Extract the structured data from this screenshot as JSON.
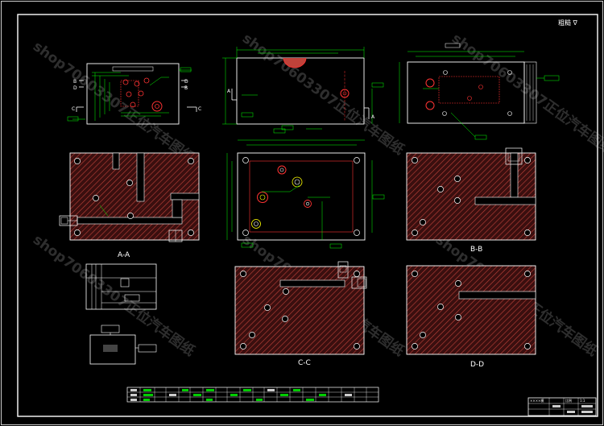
{
  "sheet": {
    "corner_mark": "粗糙 ∇",
    "watermark_text": "shop70603307正位汽车图纸"
  },
  "views": {
    "section_aa": "A-A",
    "section_bb": "B-B",
    "section_cc": "C-C",
    "section_dd": "D-D"
  },
  "view_markers": {
    "a": "A",
    "b": "B",
    "c": "C",
    "d": "D"
  },
  "title_block": {
    "cells": [
      "××××模",
      "比例",
      "1:1"
    ]
  },
  "colors": {
    "line": "#ffffff",
    "dimension": "#00ff00",
    "hole": "#ff3333",
    "hatch_bg": "#3a0f0f",
    "hatch": "#c0423a",
    "annotation": "#ffff00",
    "magenta": "#ff00ff"
  }
}
